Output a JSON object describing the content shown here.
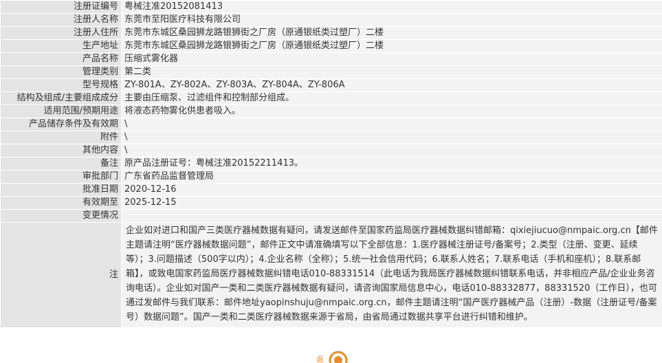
{
  "rows": [
    {
      "label": "注册证编号",
      "value": "粤械注准20152081413"
    },
    {
      "label": "注册人名称",
      "value": "东莞市至阳医疗科技有限公司"
    },
    {
      "label": "注册人住所",
      "value": "东莞市东城区桑园狮龙路银狮街之厂房（原通银纸类过塑厂）二楼"
    },
    {
      "label": "生产地址",
      "value": "东莞市东城区桑园狮龙路银狮街之厂房（原通银纸类过塑厂）二楼"
    },
    {
      "label": "产品名称",
      "value": "压缩式雾化器"
    },
    {
      "label": "管理类别",
      "value": "第二类"
    },
    {
      "label": "型号规格",
      "value": "ZY-801A、ZY-802A、ZY-803A、ZY-804A、ZY-806A"
    },
    {
      "label": "结构及组成/主要组成成分",
      "value": "主要由压缩泵、过滤组件和控制部分组成。"
    },
    {
      "label": "适用范围/预期用途",
      "value": "将液态药物雾化供患者吸入。"
    },
    {
      "label": "产品储存条件及有效期",
      "value": "\\"
    },
    {
      "label": "附件",
      "value": "\\"
    },
    {
      "label": "其他内容",
      "value": "\\"
    },
    {
      "label": "备注",
      "value": "原产品注册证号：粤械注准20152211413。"
    },
    {
      "label": "审批部门",
      "value": "广东省药品监督管理局"
    },
    {
      "label": "批准日期",
      "value": "2020-12-16"
    },
    {
      "label": "有效期至",
      "value": "2025-12-15"
    }
  ],
  "change": {
    "label": "变更情况",
    "value": ""
  },
  "note": {
    "label": "注",
    "text": "企业如对进口和国产三类医疗器械数据有疑问，请发送邮件至国家药监局医疗器械数据纠错邮箱：qixiejiucuo@nmpaic.org.cn【邮件主题请注明“医疗器械数据问题”，邮件正文中请准确填写以下全部信息：1.医疗器械注册证号/备案号；2.类型（注册、变更、延续等）；3.问题描述（500字以内）；4.企业名称（全称）；5.统一社会信用代码；6.联系人姓名；7.联系电话（手机和座机）；8.联系邮箱】，或致电国家药监局医疗器械数据纠错电话010-88331514（此电话为我局医疗器械数据纠错联系电话，并非相应产品/企业业务咨询电话）。企业如对国产一类和二类医疗器械数据有疑问，请咨询国家局信息中心，电话010-88332877，88331520（工作日），也可通过发邮件与我们联系：邮件地址yaopinshuju@nmpaic.org.cn，邮件主题请注明“国产医疗器械产品（注册）-数据（注册证号/备案号）数据问题”。国产一类和二类医疗器械数据来源于省局，由省局通过数据共享平台进行纠错和维护。"
  },
  "colors": {
    "label_bg": "#e4e4e4",
    "value_bg": "#f3f3f3",
    "logo_orange": "#f08a1c"
  },
  "icons": {
    "footer_logo": "partial-orange-logo-icon"
  }
}
